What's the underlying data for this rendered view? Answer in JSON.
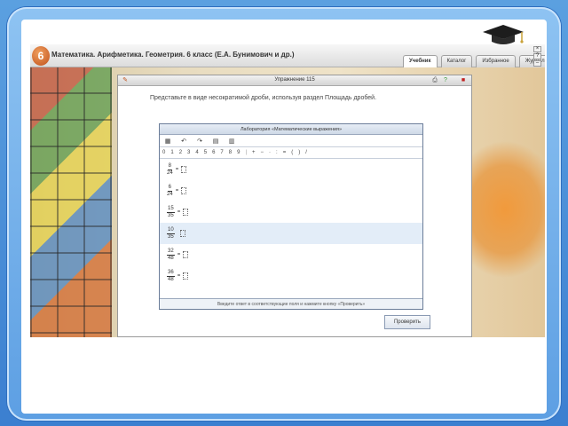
{
  "app": {
    "logo_text": "6",
    "title": "Математика. Арифметика. Геометрия. 6 класс (Е.А. Бунимович и др.)",
    "tabs": [
      "Учебник",
      "Каталог",
      "Избранное",
      "Журнал"
    ],
    "active_tab": "Учебник"
  },
  "dialog": {
    "title": "Упражнение 115",
    "instruction": "Представьте в виде несократимой дроби, используя раздел Площадь дробей.",
    "lab": {
      "header": "Лаборатория «Математические выражения»",
      "toolbar_icons": [
        "grid-icon",
        "undo-icon",
        "redo-icon",
        "table-icon",
        "matrix-icon"
      ],
      "symbols": [
        "0",
        "1",
        "2",
        "3",
        "4",
        "5",
        "6",
        "7",
        "8",
        "9",
        "|",
        "+",
        "−",
        "·",
        ":",
        "=",
        "(",
        ")",
        "/"
      ],
      "rows": [
        {
          "num": "8",
          "den": "24",
          "eq": "=",
          "highlight": false
        },
        {
          "num": "6",
          "den": "24",
          "eq": "=",
          "highlight": false
        },
        {
          "num": "15",
          "den": "35",
          "eq": "=",
          "highlight": false
        },
        {
          "num": "10",
          "den": "35",
          "eq": "",
          "highlight": true
        },
        {
          "num": "32",
          "den": "48",
          "eq": "=",
          "highlight": false
        },
        {
          "num": "36",
          "den": "48",
          "eq": "=",
          "highlight": false
        }
      ],
      "footer": "Введите ответ в соответствующие поля и нажмите кнопку «Проверить»"
    },
    "check_label": "Проверить"
  },
  "colors": {
    "frame_blue": "#5d9fe3",
    "lab_border": "#6b7d99",
    "highlight_row": "#e3edf8"
  }
}
